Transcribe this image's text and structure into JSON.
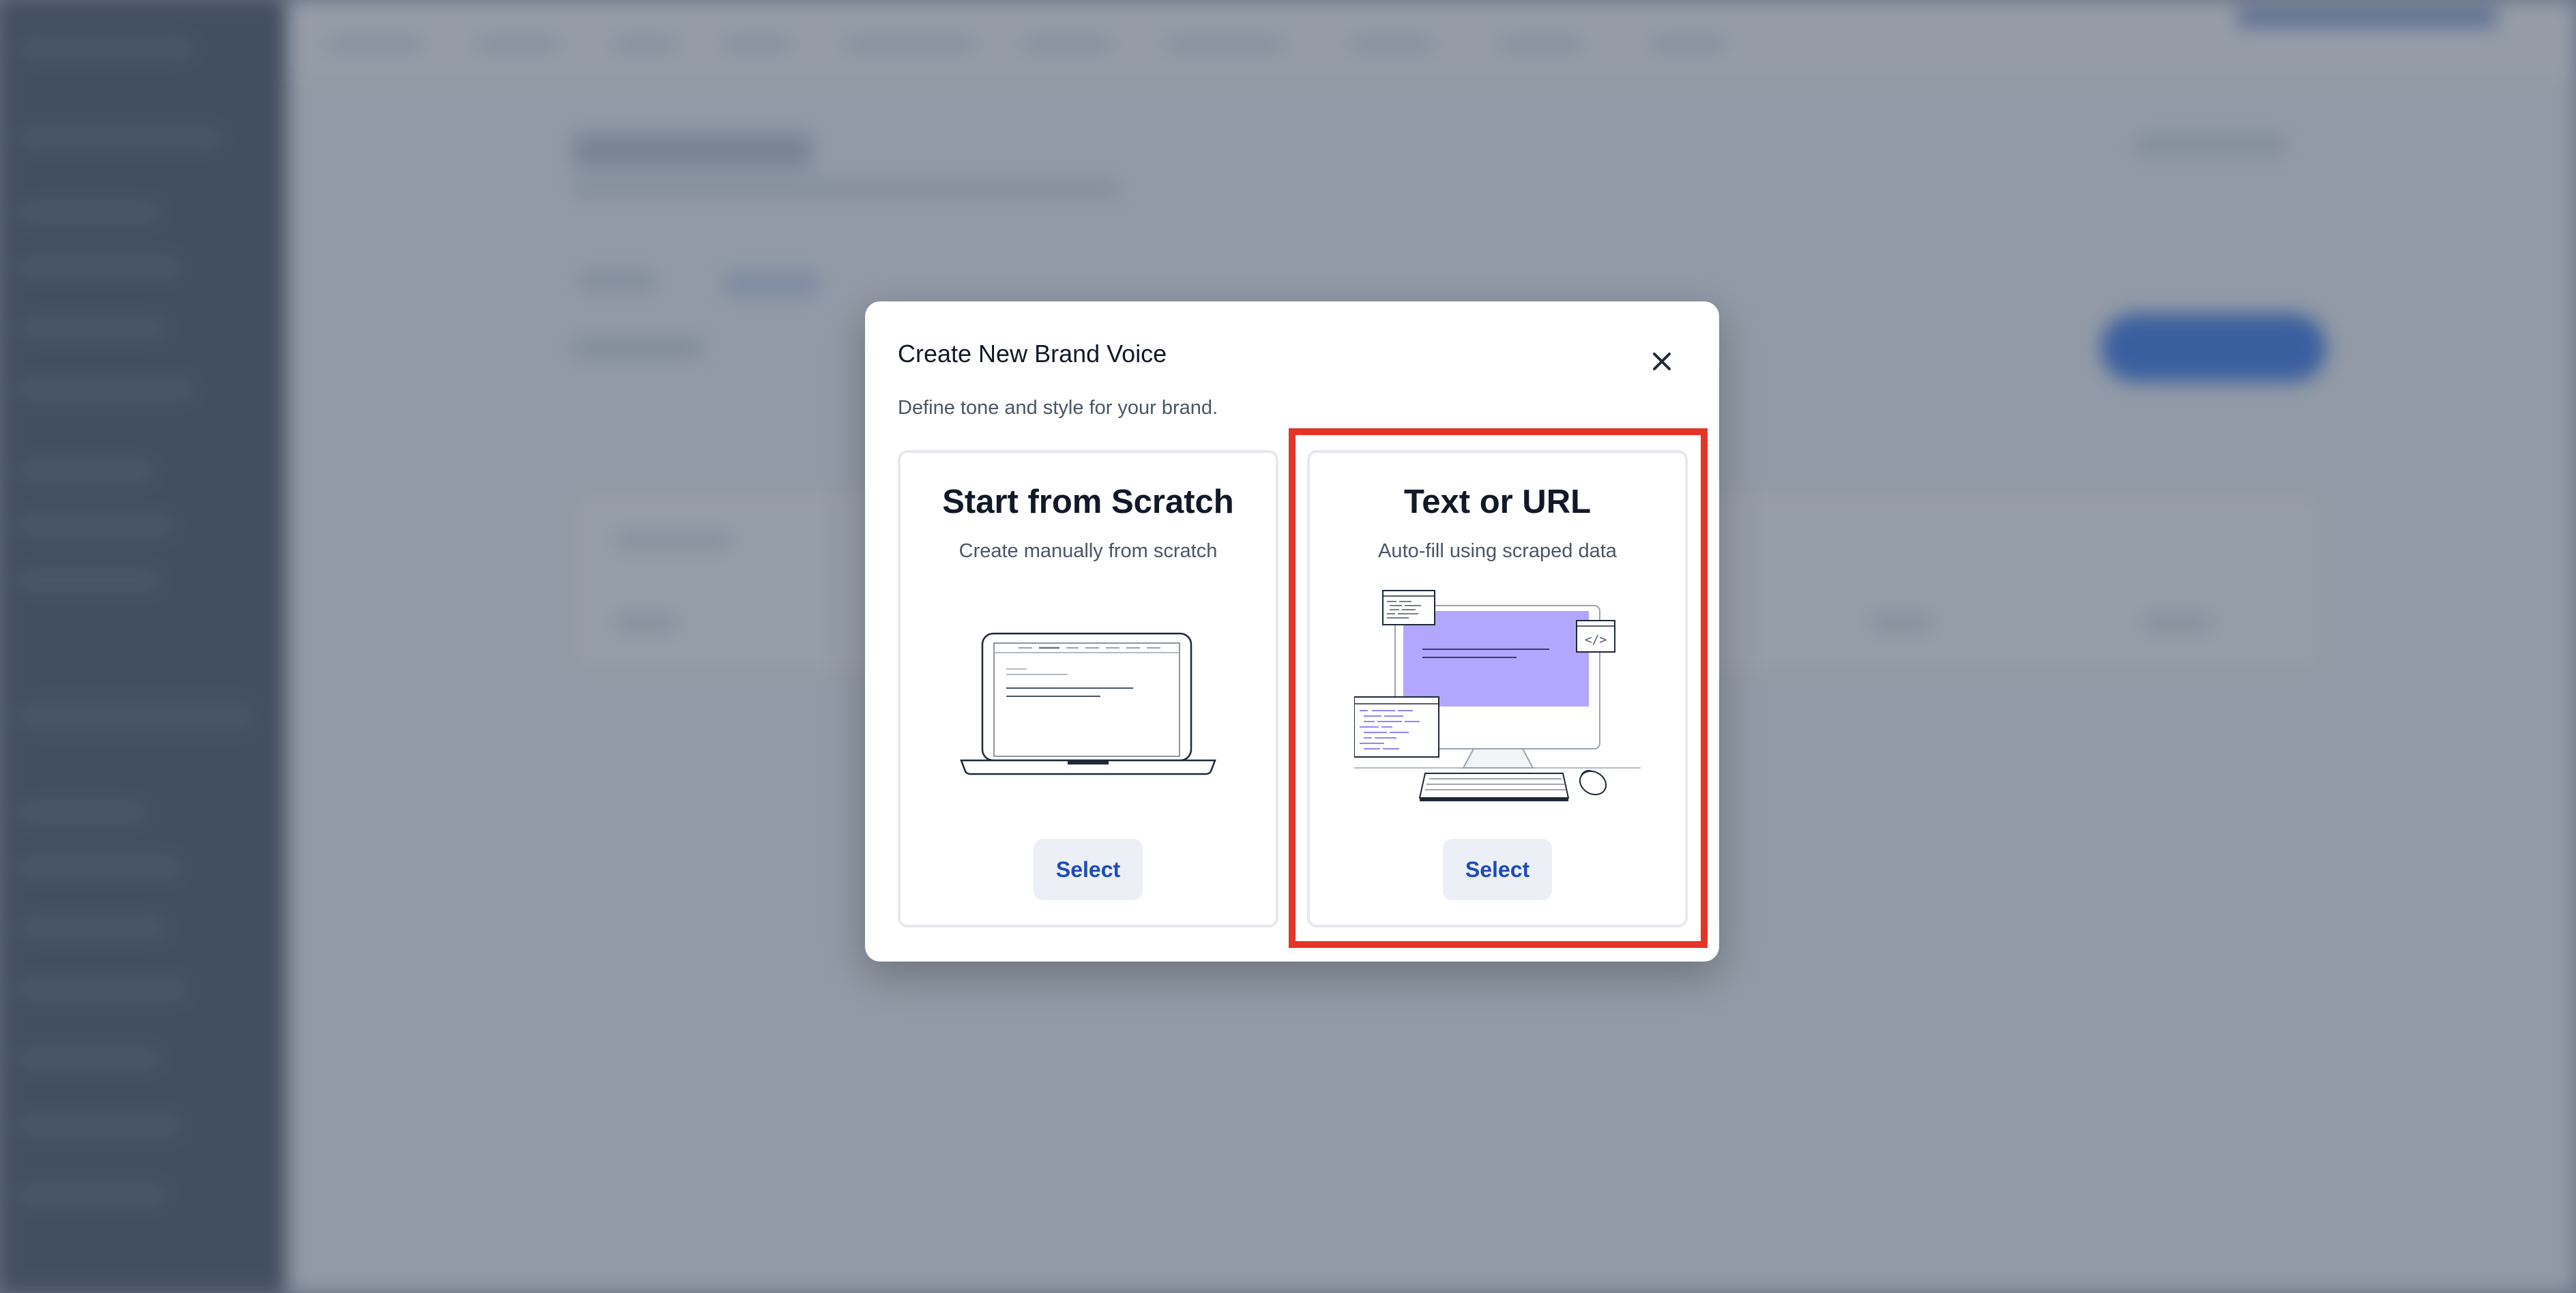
{
  "modal": {
    "title": "Create New Brand Voice",
    "description": "Define tone and style for your brand.",
    "close_icon": "close-icon"
  },
  "options": [
    {
      "title": "Start from Scratch",
      "subtitle": "Create manually from scratch",
      "illustration": "laptop-illustration",
      "button_label": "Select"
    },
    {
      "title": "Text or URL",
      "subtitle": "Auto-fill using scraped data",
      "illustration": "desktop-code-illustration",
      "button_label": "Select",
      "highlighted": true
    }
  ],
  "colors": {
    "accent": "#1f4bb8",
    "highlight": "#e53528",
    "illustration_fill": "#b3a6ff"
  }
}
